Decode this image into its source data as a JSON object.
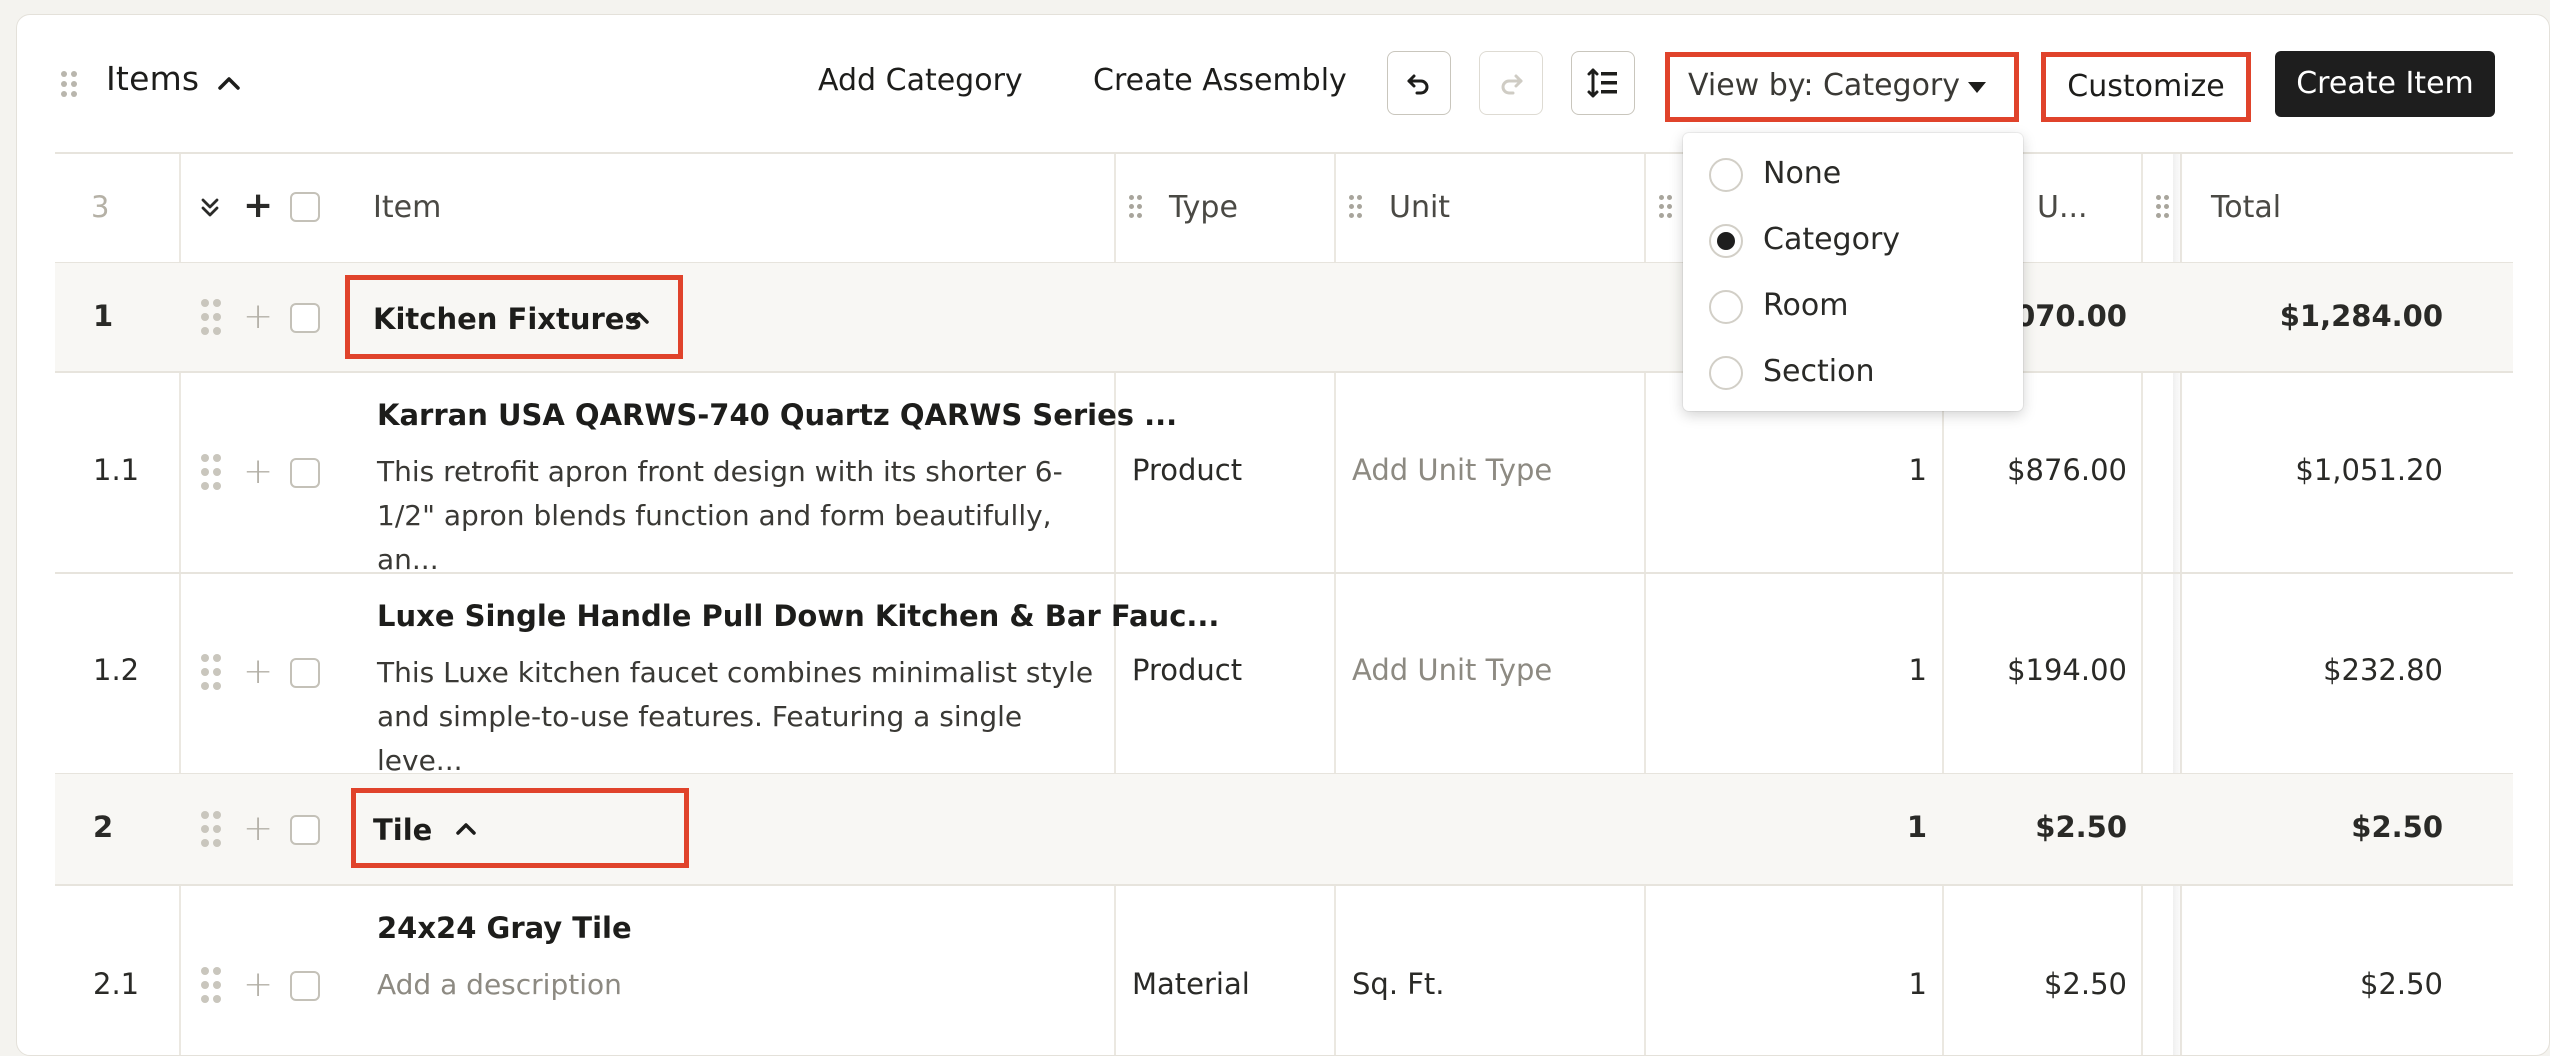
{
  "header": {
    "title": "Items",
    "add_category": "Add Category",
    "create_assembly": "Create Assembly",
    "view_by": "View by: Category",
    "customize": "Customize",
    "create_item": "Create Item"
  },
  "table": {
    "header_count": "3",
    "columns": {
      "item": "Item",
      "type": "Type",
      "unit": "Unit",
      "unit_cost_truncated": "U...",
      "total": "Total"
    },
    "groups": [
      {
        "number": "1",
        "name": "Kitchen Fixtures",
        "unit_cost_partial": "070.00",
        "total": "$1,284.00",
        "items": [
          {
            "number": "1.1",
            "name": "Karran USA QARWS-740 Quartz QARWS Series ...",
            "desc_line1": "This retrofit apron front design with its shorter 6-",
            "desc_line2": "1/2\" apron blends function and form beautifully, an...",
            "type": "Product",
            "unit": "Add Unit Type",
            "qty": "1",
            "unit_cost": "$876.00",
            "total": "$1,051.20"
          },
          {
            "number": "1.2",
            "name": "Luxe Single Handle Pull Down Kitchen & Bar Fauc...",
            "desc_line1": "This Luxe kitchen faucet combines minimalist style",
            "desc_line2": "and simple-to-use features. Featuring a single leve...",
            "type": "Product",
            "unit": "Add Unit Type",
            "qty": "1",
            "unit_cost": "$194.00",
            "total": "$232.80"
          }
        ]
      },
      {
        "number": "2",
        "name": "Tile",
        "qty": "1",
        "unit_cost": "$2.50",
        "total": "$2.50",
        "items": [
          {
            "number": "2.1",
            "name": "24x24 Gray Tile",
            "desc": "Add a description",
            "type": "Material",
            "unit": "Sq. Ft.",
            "qty": "1",
            "unit_cost": "$2.50",
            "total": "$2.50"
          }
        ]
      }
    ]
  },
  "view_menu": {
    "options": [
      "None",
      "Category",
      "Room",
      "Section"
    ],
    "selected": "Category"
  },
  "colors": {
    "highlight": "#e0432b",
    "primary_button": "#1e1e1e"
  }
}
